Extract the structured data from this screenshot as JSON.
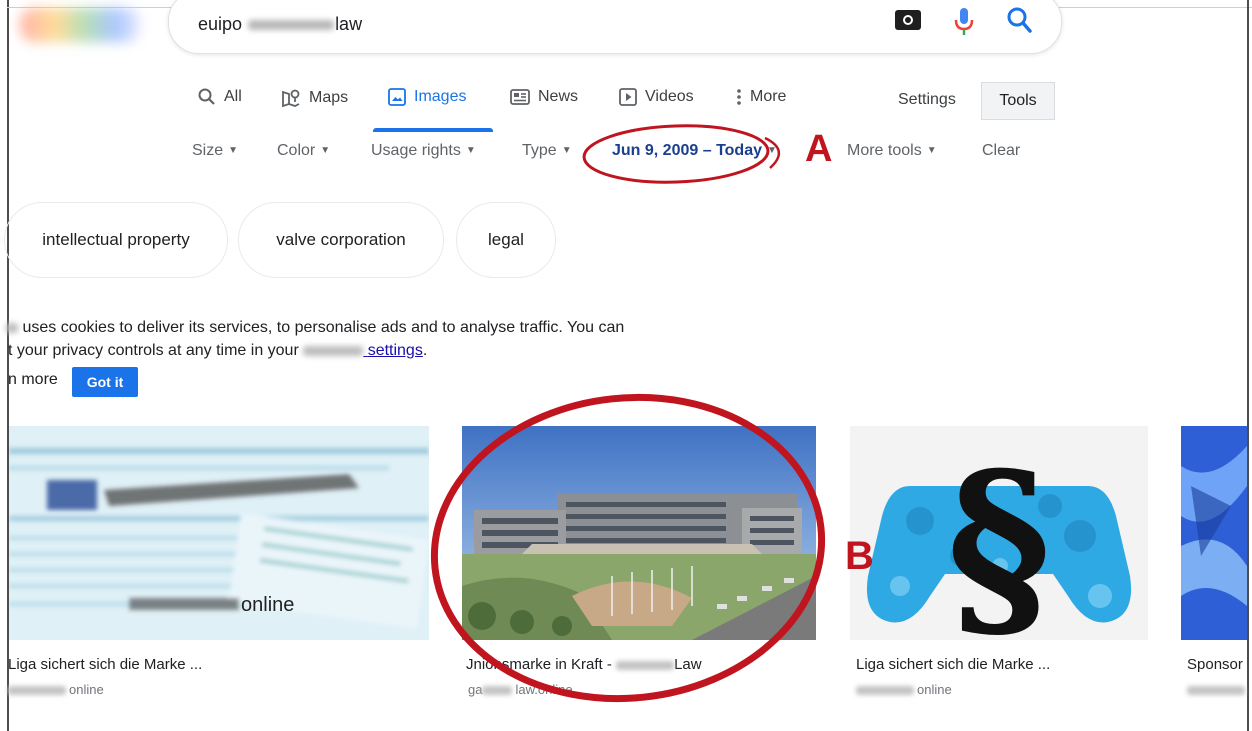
{
  "search": {
    "query_prefix": "euipo",
    "query_suffix": "law"
  },
  "nav": {
    "tabs": [
      {
        "label": "All",
        "active": false
      },
      {
        "label": "Maps",
        "active": false
      },
      {
        "label": "Images",
        "active": true
      },
      {
        "label": "News",
        "active": false
      },
      {
        "label": "Videos",
        "active": false
      },
      {
        "label": "More",
        "active": false
      }
    ],
    "settings_label": "Settings",
    "tools_label": "Tools"
  },
  "tools": {
    "size": "Size",
    "color": "Color",
    "usage_rights": "Usage rights",
    "type": "Type",
    "date_range": "Jun 9, 2009 – Today",
    "more_tools": "More tools",
    "clear": "Clear"
  },
  "chips": [
    "intellectual property",
    "valve corporation",
    "legal"
  ],
  "cookie": {
    "line1": "uses cookies to deliver its services, to personalise ads and to analyse traffic. You can",
    "line2_prefix": "t your privacy controls at any time in your",
    "line2_link": "settings",
    "line2_suffix": ".",
    "learn_more": "n more",
    "got_it": "Got it"
  },
  "results": [
    {
      "caption": "Liga sichert sich die Marke ...",
      "source": "online",
      "thumb_text": "online"
    },
    {
      "caption_prefix": "Jnionsmarke in Kraft -",
      "caption_suffix": "Law",
      "source_prefix": "ga",
      "source_suffix": "law.online"
    },
    {
      "caption": "Liga sichert sich die Marke ...",
      "source": "online"
    },
    {
      "caption": "Sponsor"
    }
  ],
  "annotations": {
    "a": "A",
    "b": "B"
  },
  "colors": {
    "accent_blue": "#1a73e8",
    "date_blue": "#1a3f8f",
    "annotation_red": "#c0141f"
  }
}
